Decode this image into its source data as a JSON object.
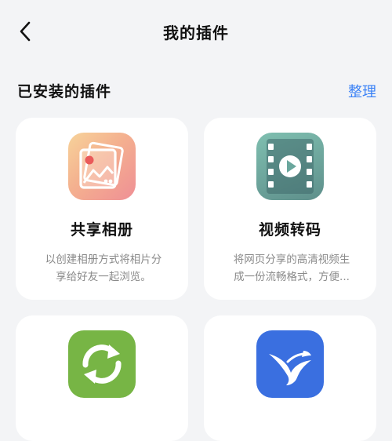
{
  "header": {
    "title": "我的插件"
  },
  "section": {
    "title": "已安装的插件",
    "manage_label": "整理"
  },
  "plugins": [
    {
      "title": "共享相册",
      "desc_line1": "以创建相册方式将相片分",
      "desc_line2": "享给好友一起浏览。",
      "icon": "photo-album-icon"
    },
    {
      "title": "视频转码",
      "desc_line1": "将网页分享的高清视频生",
      "desc_line2": "成一份流畅格式，方便...",
      "icon": "video-transcode-icon"
    },
    {
      "title": "",
      "icon": "sync-icon"
    },
    {
      "title": "",
      "icon": "bird-icon"
    }
  ]
}
